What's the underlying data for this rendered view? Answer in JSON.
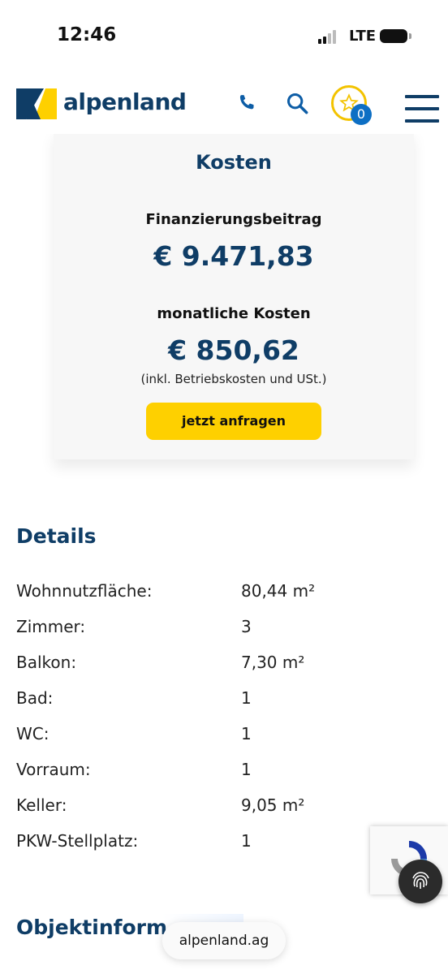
{
  "status_bar": {
    "time": "12:46",
    "network": "LTE"
  },
  "header": {
    "brand": "alpenland",
    "icons": [
      "phone-icon",
      "search-icon",
      "favorites-star-icon",
      "menu-icon"
    ],
    "favorites_count": "0",
    "colors": {
      "brand_blue": "#0f3d66",
      "accent_yellow": "#fed000",
      "badge_blue": "#0d6fc4"
    }
  },
  "costs": {
    "title": "Kosten",
    "financing_label": "Finanzierungsbeitrag",
    "financing_amount": "€ 9.471,83",
    "monthly_label": "monatliche Kosten",
    "monthly_amount": "€ 850,62",
    "monthly_note": "(inkl. Betriebskosten und USt.)",
    "cta_label": "jetzt anfragen"
  },
  "details": {
    "title": "Details",
    "rows": [
      {
        "label": "Wohnnutzfläche:",
        "value": "80,44 m²"
      },
      {
        "label": "Zimmer:",
        "value": "3"
      },
      {
        "label": "Balkon:",
        "value": "7,30 m²"
      },
      {
        "label": "Bad:",
        "value": "1"
      },
      {
        "label": "WC:",
        "value": "1"
      },
      {
        "label": "Vorraum:",
        "value": "1"
      },
      {
        "label": "Keller:",
        "value": "9,05 m²"
      },
      {
        "label": "PKW-Stellplatz:",
        "value": "1"
      }
    ]
  },
  "object_info": {
    "title": "Objektinform"
  },
  "browser": {
    "url": "alpenland.ag"
  }
}
